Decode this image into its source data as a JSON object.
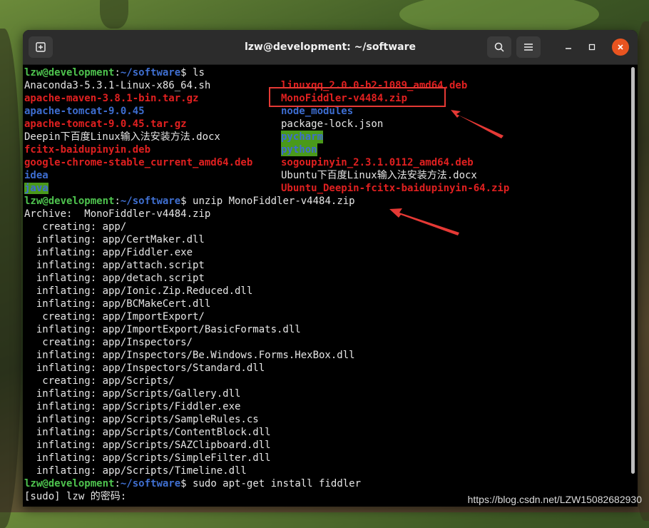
{
  "window": {
    "title": "lzw@development: ~/software"
  },
  "terminal": {
    "prompt_user": "lzw@development",
    "prompt_sep": ":",
    "prompt_path": "~/software",
    "prompt_dollar": "$",
    "cmd1": " ls",
    "ls_col1": [
      {
        "text": "Anaconda3-5.3.1-Linux-x86_64.sh",
        "style": "plain"
      },
      {
        "text": "apache-maven-3.8.1-bin.tar.gz",
        "style": "red"
      },
      {
        "text": "apache-tomcat-9.0.45",
        "style": "blue"
      },
      {
        "text": "apache-tomcat-9.0.45.tar.gz",
        "style": "red"
      },
      {
        "text": "Deepin下百度Linux输入法安装方法.docx",
        "style": "plain"
      },
      {
        "text": "fcitx-baidupinyin.deb",
        "style": "red"
      },
      {
        "text": "google-chrome-stable_current_amd64.deb",
        "style": "red"
      },
      {
        "text": "idea",
        "style": "blue"
      },
      {
        "text": "java",
        "style": "hl"
      }
    ],
    "ls_col2": [
      {
        "text": "linuxqq_2.0.0-b2-1089_amd64.deb",
        "style": "red"
      },
      {
        "text": "MonoFiddler-v4484.zip",
        "style": "red"
      },
      {
        "text": "node_modules",
        "style": "blue"
      },
      {
        "text": "package-lock.json",
        "style": "plain"
      },
      {
        "text": "pycharm",
        "style": "hl"
      },
      {
        "text": "python",
        "style": "hl"
      },
      {
        "text": "sogoupinyin_2.3.1.0112_amd64.deb",
        "style": "red"
      },
      {
        "text": "Ubuntu下百度Linux输入法安装方法.docx",
        "style": "plain"
      },
      {
        "text": "Ubuntu_Deepin-fcitx-baidupinyin-64.zip",
        "style": "red"
      }
    ],
    "cmd2": " unzip MonoFiddler-v4484.zip",
    "unzip_output": [
      "Archive:  MonoFiddler-v4484.zip",
      "   creating: app/",
      "  inflating: app/CertMaker.dll",
      "  inflating: app/Fiddler.exe",
      "  inflating: app/attach.script",
      "  inflating: app/detach.script",
      "  inflating: app/Ionic.Zip.Reduced.dll",
      "  inflating: app/BCMakeCert.dll",
      "   creating: app/ImportExport/",
      "  inflating: app/ImportExport/BasicFormats.dll",
      "   creating: app/Inspectors/",
      "  inflating: app/Inspectors/Be.Windows.Forms.HexBox.dll",
      "  inflating: app/Inspectors/Standard.dll",
      "   creating: app/Scripts/",
      "  inflating: app/Scripts/Gallery.dll",
      "  inflating: app/Scripts/Fiddler.exe",
      "  inflating: app/Scripts/SampleRules.cs",
      "  inflating: app/Scripts/ContentBlock.dll",
      "  inflating: app/Scripts/SAZClipboard.dll",
      "  inflating: app/Scripts/SimpleFilter.dll",
      "  inflating: app/Scripts/Timeline.dll"
    ],
    "cmd3": " sudo apt-get install fiddler",
    "sudo_prompt": "[sudo] lzw 的密码:"
  },
  "watermark": "https://blog.csdn.net/LZW15082682930",
  "colors": {
    "close_button": "#e95420",
    "annotation": "#e53935"
  },
  "icons": [
    "new-tab-icon",
    "search-icon",
    "hamburger-menu-icon",
    "minimize-icon",
    "maximize-icon",
    "close-icon"
  ]
}
